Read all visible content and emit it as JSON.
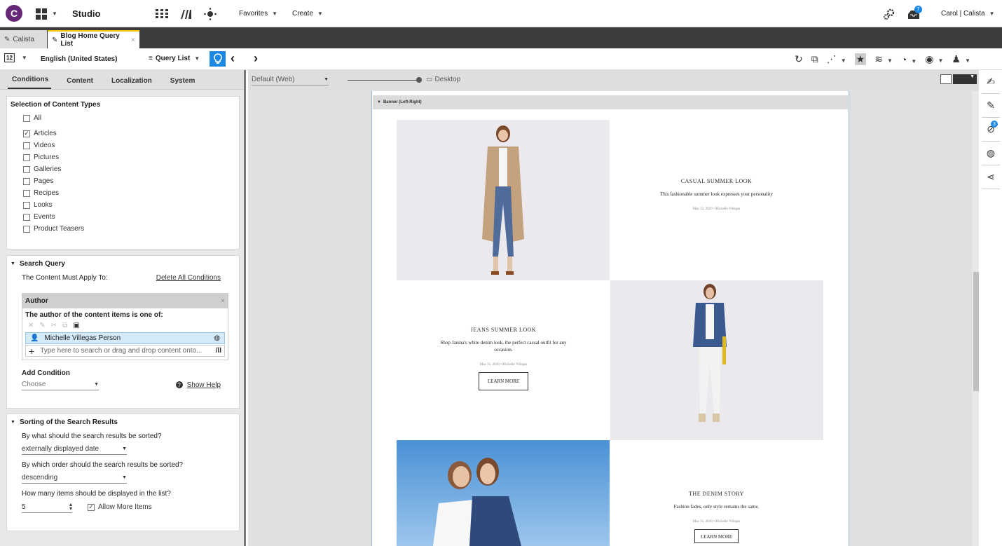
{
  "top": {
    "app_title": "Studio",
    "favorites": "Favorites",
    "create": "Create",
    "user": "Carol | Calista",
    "notif_badge": "7"
  },
  "tabs": [
    {
      "label": "Calista"
    },
    {
      "label": "Blog Home Query List"
    }
  ],
  "toolbar": {
    "page_no": "12",
    "locale": "English (United States)",
    "view": "Query List"
  },
  "left_tabs": [
    "Conditions",
    "Content",
    "Localization",
    "System"
  ],
  "content_types": {
    "title": "Selection of Content Types",
    "items": [
      {
        "label": "All",
        "checked": false
      },
      {
        "label": "Articles",
        "checked": true
      },
      {
        "label": "Videos",
        "checked": false
      },
      {
        "label": "Pictures",
        "checked": false
      },
      {
        "label": "Galleries",
        "checked": false
      },
      {
        "label": "Pages",
        "checked": false
      },
      {
        "label": "Recipes",
        "checked": false
      },
      {
        "label": "Looks",
        "checked": false
      },
      {
        "label": "Events",
        "checked": false
      },
      {
        "label": "Product Teasers",
        "checked": false
      }
    ]
  },
  "search_query": {
    "title": "Search Query",
    "apply_label": "The Content Must Apply To:",
    "delete_all": "Delete All Conditions",
    "author_box": {
      "title": "Author",
      "desc": "The author of the content items is one of:",
      "person": "Michelle Villegas Person",
      "placeholder": "Type here to search or drag and drop content onto..."
    },
    "add_condition": "Add Condition",
    "choose": "Choose",
    "show_help": "Show Help"
  },
  "sorting": {
    "title": "Sorting of the Search Results",
    "q1": "By what should the search results be sorted?",
    "v1": "externally displayed date",
    "q2": "By which order should the search results be sorted?",
    "v2": "descending",
    "q3": "How many items should be displayed in the list?",
    "v3": "5",
    "allow_more": "Allow More Items"
  },
  "preview": {
    "channel": "Default (Web)",
    "device": "Desktop",
    "banner": "Banner (Left-Right)",
    "items": [
      {
        "title": "CASUAL SUMMER LOOK",
        "sub": "This fashionable summer look expresses your personality",
        "meta": "May 22, 2020 • Michelle Villegas"
      },
      {
        "title": "JEANS SUMMER LOOK",
        "sub": "Shop Janina's white denim look, the perfect casual outfit for any occasion.",
        "meta": "May 21, 2020 • Michelle Villegas",
        "btn": "LEARN MORE"
      },
      {
        "title": "THE DENIM STORY",
        "sub": "Fashion fades, only style remains the same.",
        "meta": "May 21, 2020 • Michelle Villegas",
        "btn": "LEARN MORE"
      }
    ]
  },
  "colors": {
    "brand": "#672779",
    "accent": "#1e88e5"
  }
}
